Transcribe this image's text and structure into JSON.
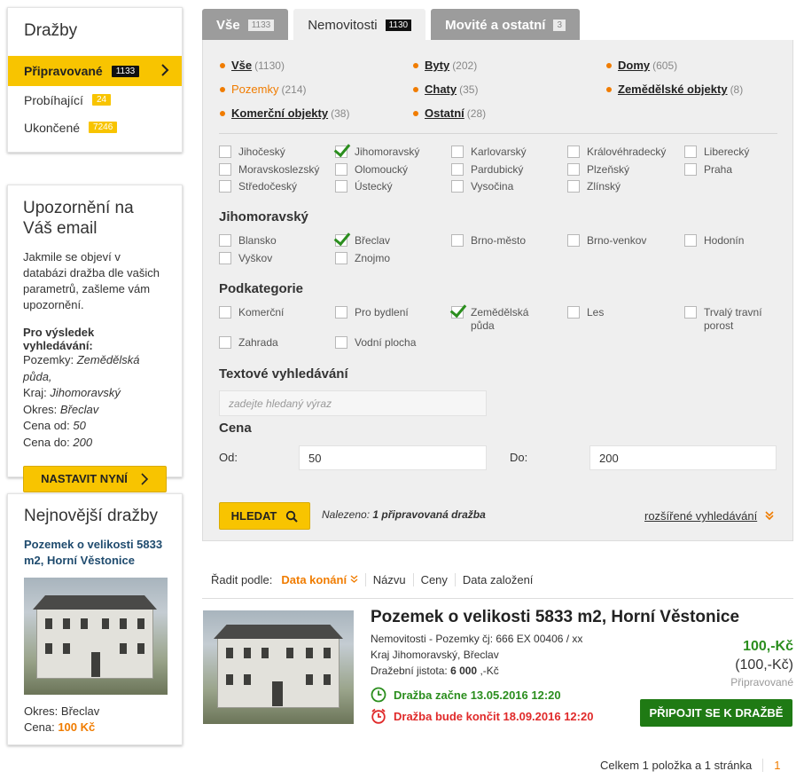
{
  "sidebar": {
    "auctions": {
      "title": "Dražby",
      "items": [
        {
          "label": "Připravované",
          "count": "1133"
        },
        {
          "label": "Probíhající",
          "count": "24"
        },
        {
          "label": "Ukončené",
          "count": "7246"
        }
      ]
    },
    "alert": {
      "title": "Upozornění na Váš email",
      "text": "Jakmile se objeví v databázi dražba dle vašich parametrů, zašleme vám upozornění.",
      "result_heading": "Pro výsledek vyhledávání:",
      "params": [
        {
          "k": "Pozemky:",
          "v": "Zemědělská půda,"
        },
        {
          "k": "Kraj:",
          "v": "Jihomoravský"
        },
        {
          "k": "Okres:",
          "v": "Břeclav"
        },
        {
          "k": "Cena od:",
          "v": "50"
        },
        {
          "k": "Cena do:",
          "v": "200"
        }
      ],
      "button": "NASTAVIT NYNÍ"
    },
    "newest": {
      "title": "Nejnovější dražby",
      "link": "Pozemek o velikosti 5833 m2, Horní Věstonice",
      "district_label": "Okres:",
      "district": "Břeclav",
      "price_label": "Cena:",
      "price": "100 Kč"
    }
  },
  "tabs": [
    {
      "label": "Vše",
      "count": "1133"
    },
    {
      "label": "Nemovitosti",
      "count": "1130"
    },
    {
      "label": "Movité a ostatní",
      "count": "3"
    }
  ],
  "categories": [
    {
      "label": "Vše",
      "count": "(1130)"
    },
    {
      "label": "Byty",
      "count": "(202)"
    },
    {
      "label": "Domy",
      "count": "(605)"
    },
    {
      "label": "Pozemky",
      "count": "(214)"
    },
    {
      "label": "Chaty",
      "count": "(35)"
    },
    {
      "label": "Zemědělské objekty",
      "count": "(8)"
    },
    {
      "label": "Komerční objekty",
      "count": "(38)"
    },
    {
      "label": "Ostatní",
      "count": "(28)"
    }
  ],
  "regions": [
    "Jihočeský",
    "Jihomoravský",
    "Karlovarský",
    "Královéhradecký",
    "Liberecký",
    "Moravskoslezský",
    "Olomoucký",
    "Pardubický",
    "Plzeňský",
    "Praha",
    "Středočeský",
    "Ústecký",
    "Vysočina",
    "Zlínský"
  ],
  "district_heading": "Jihomoravský",
  "districts": [
    "Blansko",
    "Břeclav",
    "Brno-město",
    "Brno-venkov",
    "Hodonín",
    "Vyškov",
    "Znojmo"
  ],
  "subcat_heading": "Podkategorie",
  "subcats": [
    "Komerční",
    "Pro bydlení",
    "Zemědělská půda",
    "Les",
    "Trvalý travní porost",
    "Zahrada",
    "Vodní plocha"
  ],
  "text_search": {
    "heading": "Textové vyhledávání",
    "placeholder": "zadejte hledaný výraz"
  },
  "price": {
    "heading": "Cena",
    "from_label": "Od:",
    "from": "50",
    "to_label": "Do:",
    "to": "200"
  },
  "search_button": "HLEDAT",
  "found": {
    "label": "Nalezeno:",
    "value": "1 připravovaná dražba"
  },
  "advanced": "rozšířené vyhledávání",
  "sort": {
    "label": "Řadit podle:",
    "options": [
      "Data konání",
      "Názvu",
      "Ceny",
      "Data založení"
    ]
  },
  "result": {
    "title": "Pozemek o velikosti 5833 m2, Horní Věstonice",
    "line1": "Nemovitosti - Pozemky čj: 666 EX 00406 / xx",
    "line2": "Kraj Jihomoravský, Břeclav",
    "deposit_label": "Dražební jistota:",
    "deposit": "6 000",
    "deposit_unit": ",-Kč",
    "price": "100,-Kč",
    "price2": "(100,-Kč)",
    "state": "Připravované",
    "start": "Dražba začne 13.05.2016 12:20",
    "end": "Dražba bude končit 18.09.2016 12:20",
    "button": "PŘIPOJIT SE K DRAŽBĚ"
  },
  "pagination": {
    "summary": "Celkem 1 položka a 1 stránka",
    "page": "1"
  },
  "colors": {
    "accent": "#f8c400",
    "orange": "#f07c00",
    "green": "#2b8e1e",
    "red": "#e02a2a",
    "button_green": "#1f7a14"
  }
}
